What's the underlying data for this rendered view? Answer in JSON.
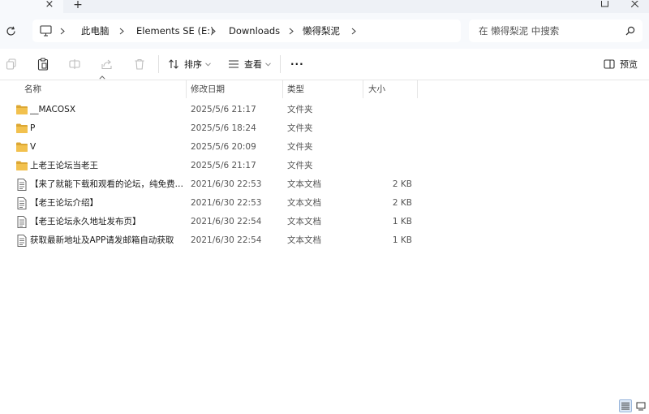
{
  "window": {
    "close_tab_glyph": "×",
    "new_tab_glyph": "+"
  },
  "breadcrumb": [
    {
      "label": "此电脑"
    },
    {
      "label": "Elements SE (E:)"
    },
    {
      "label": "Downloads"
    },
    {
      "label": "懒得梨泥"
    }
  ],
  "search": {
    "placeholder": "在 懒得梨泥 中搜索"
  },
  "toolbar": {
    "sort_label": "排序",
    "view_label": "查看",
    "more_label": "···",
    "preview_label": "预览"
  },
  "columns": {
    "name": "名称",
    "modified": "修改日期",
    "type": "类型",
    "size": "大小"
  },
  "files": [
    {
      "name": "__MACOSX",
      "modified": "2025/5/6 21:17",
      "type": "文件夹",
      "size": "",
      "icon": "folder-icon"
    },
    {
      "name": "P",
      "modified": "2025/5/6 18:24",
      "type": "文件夹",
      "size": "",
      "icon": "folder-icon"
    },
    {
      "name": "V",
      "modified": "2025/5/6 20:09",
      "type": "文件夹",
      "size": "",
      "icon": "folder-icon"
    },
    {
      "name": "上老王论坛当老王",
      "modified": "2025/5/6 21:17",
      "type": "文件夹",
      "size": "",
      "icon": "folder-icon"
    },
    {
      "name": "【来了就能下载和观看的论坛，纯免费！…",
      "modified": "2021/6/30 22:53",
      "type": "文本文档",
      "size": "2 KB",
      "icon": "text-file-icon"
    },
    {
      "name": "【老王论坛介绍】",
      "modified": "2021/6/30 22:53",
      "type": "文本文档",
      "size": "2 KB",
      "icon": "text-file-icon"
    },
    {
      "name": "【老王论坛永久地址发布页】",
      "modified": "2021/6/30 22:54",
      "type": "文本文档",
      "size": "1 KB",
      "icon": "text-file-icon"
    },
    {
      "name": "获取最新地址及APP请发邮箱自动获取",
      "modified": "2021/6/30 22:54",
      "type": "文本文档",
      "size": "1 KB",
      "icon": "text-file-icon"
    }
  ],
  "colors": {
    "folder": "#f2c14e",
    "folder_dark": "#dca733",
    "accent": "#0067c0",
    "active_view_bg": "#dde8f6"
  }
}
